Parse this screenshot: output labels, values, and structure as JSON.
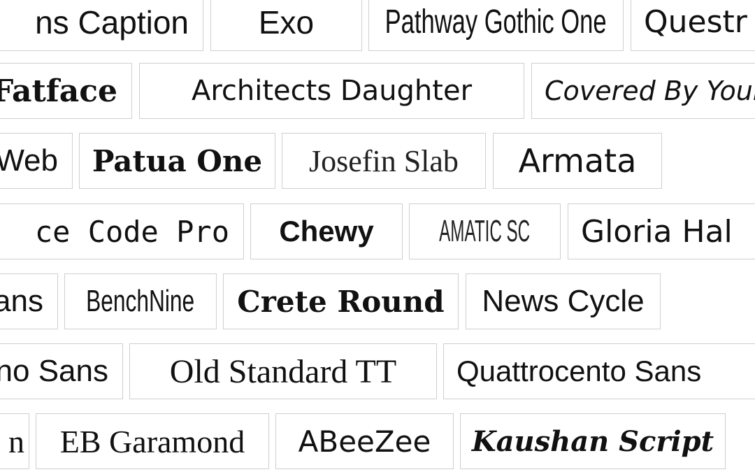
{
  "tiles": [
    {
      "label": "ns Caption"
    },
    {
      "label": "Exo"
    },
    {
      "label": "Pathway Gothic One"
    },
    {
      "label": "Questr"
    },
    {
      "label": "Fatface"
    },
    {
      "label": "Architects Daughter"
    },
    {
      "label": "Covered By Your"
    },
    {
      "label": "Web"
    },
    {
      "label": "Patua One"
    },
    {
      "label": "Josefin Slab"
    },
    {
      "label": "Armata"
    },
    {
      "label": "ce Code Pro"
    },
    {
      "label": "Chewy"
    },
    {
      "label": "AMATIC SC"
    },
    {
      "label": "Gloria Hal"
    },
    {
      "label": "ans"
    },
    {
      "label": "BenchNine"
    },
    {
      "label": "Crete Round"
    },
    {
      "label": "News Cycle"
    },
    {
      "label": "no Sans"
    },
    {
      "label": "Old Standard TT"
    },
    {
      "label": "Quattrocento Sans"
    },
    {
      "label": "n"
    },
    {
      "label": "EB Garamond"
    },
    {
      "label": "ABeeZee"
    },
    {
      "label": "Kaushan Script"
    }
  ],
  "colors": {
    "border": "#cfcfcf",
    "text": "#111111",
    "background": "#ffffff"
  }
}
